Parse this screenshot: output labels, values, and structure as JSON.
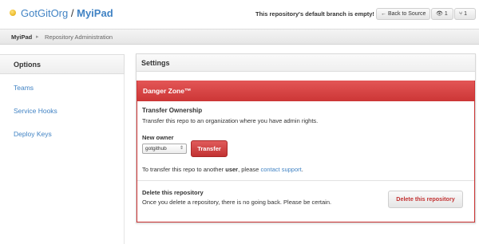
{
  "header": {
    "owner": "GotGitOrg",
    "separator": "/",
    "repo": "MyiPad",
    "branch_message": "This repository's default branch is empty!",
    "back_button": "← Back to Source",
    "watch_button": "👁 1",
    "fork_button": "⑂ 1",
    "repo_icon": "repo-star-icon"
  },
  "breadcrumb": {
    "repo": "MyiPad",
    "arrow": "▸",
    "page": "Repository Administration"
  },
  "sidebar": {
    "heading": "Options",
    "items": [
      {
        "label": "Teams"
      },
      {
        "label": "Service Hooks"
      },
      {
        "label": "Deploy Keys"
      }
    ]
  },
  "settings": {
    "heading": "Settings",
    "danger_zone": "Danger Zone™",
    "transfer": {
      "heading": "Transfer Ownership",
      "description": "Transfer this repo to an organization where you have admin rights.",
      "owner_label": "New owner",
      "owner_value": "gotgithub",
      "owner_chevron": "⇕",
      "button": "Transfer",
      "note_prefix": "To transfer this repo to another ",
      "note_bold": "user",
      "note_mid": ", please ",
      "note_link": "contact support",
      "note_suffix": "."
    },
    "delete": {
      "heading": "Delete this repository",
      "description": "Once you delete a repository, there is no going back. Please be certain.",
      "button": "Delete this repository"
    }
  },
  "colors": {
    "link": "#4183c4",
    "danger": "#cc3636"
  }
}
